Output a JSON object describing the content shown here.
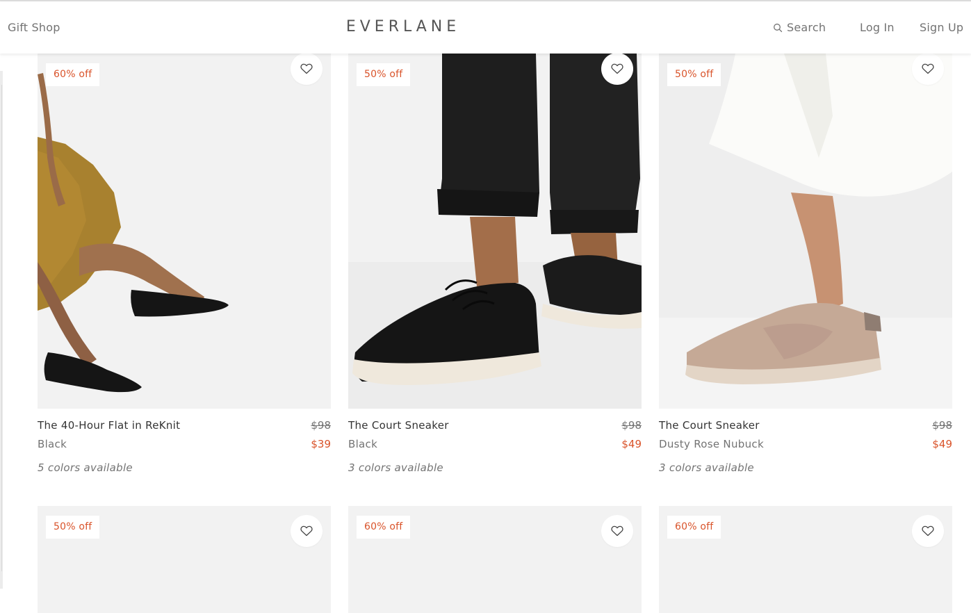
{
  "header": {
    "gift_shop": "Gift Shop",
    "logo": "EVERLANE",
    "search_label": "Search",
    "login_label": "Log In",
    "signup_label": "Sign Up"
  },
  "colors": {
    "accent": "#d9532a",
    "text": "#333333",
    "muted": "#737373",
    "image_bg": "#f2f2f2"
  },
  "products": [
    {
      "badge": "60% off",
      "name": "The 40-Hour Flat in ReKnit",
      "color": "Black",
      "old_price": "$98",
      "new_price": "$39",
      "colors_available": "5 colors available",
      "wishlist_icon": "heart-icon"
    },
    {
      "badge": "50% off",
      "name": "The Court Sneaker",
      "color": "Black",
      "old_price": "$98",
      "new_price": "$49",
      "colors_available": "3 colors available",
      "wishlist_icon": "heart-icon"
    },
    {
      "badge": "50% off",
      "name": "The Court Sneaker",
      "color": "Dusty Rose Nubuck",
      "old_price": "$98",
      "new_price": "$49",
      "colors_available": "3 colors available",
      "wishlist_icon": "heart-icon"
    },
    {
      "badge": "50% off",
      "wishlist_icon": "heart-icon"
    },
    {
      "badge": "60% off",
      "wishlist_icon": "heart-icon"
    },
    {
      "badge": "60% off",
      "wishlist_icon": "heart-icon"
    }
  ]
}
